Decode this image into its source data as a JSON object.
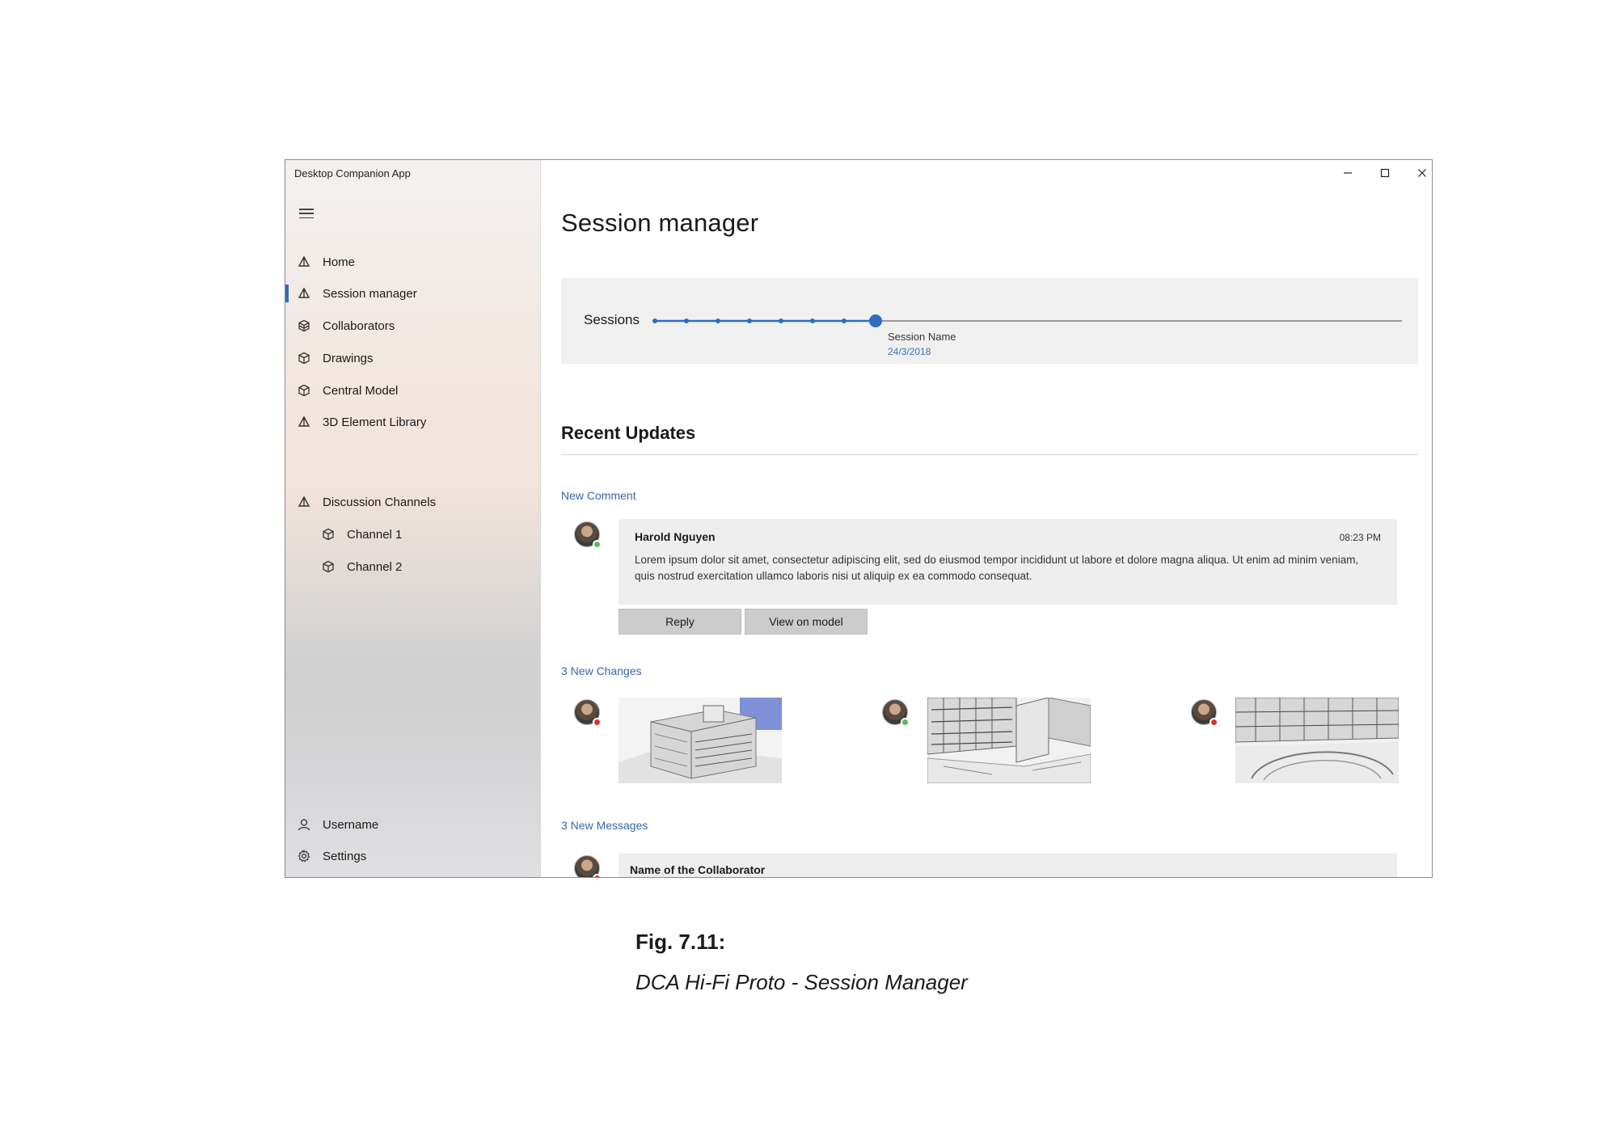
{
  "app": {
    "title": "Desktop Companion App",
    "accent_color": "#2f6dbd",
    "window_controls": [
      "minimize-icon",
      "maximize-icon",
      "close-icon"
    ]
  },
  "sidebar": {
    "menu_icon": "hamburger-icon",
    "items": [
      {
        "label": "Home",
        "icon": "pyramid-icon"
      },
      {
        "label": "Session manager",
        "icon": "pyramid-icon",
        "active": true
      },
      {
        "label": "Collaborators",
        "icon": "cube-stack-icon"
      },
      {
        "label": "Drawings",
        "icon": "cube-icon"
      },
      {
        "label": "Central Model",
        "icon": "cube-icon"
      },
      {
        "label": "3D Element Library",
        "icon": "pyramid-icon"
      }
    ],
    "channels": {
      "label": "Discussion Channels",
      "icon": "pyramid-icon",
      "items": [
        {
          "label": "Channel 1",
          "icon": "cube-icon"
        },
        {
          "label": "Channel 2",
          "icon": "cube-icon"
        }
      ]
    },
    "footer": [
      {
        "label": "Username",
        "icon": "person-icon"
      },
      {
        "label": "Settings",
        "icon": "gear-icon"
      }
    ]
  },
  "main": {
    "title": "Session manager",
    "sessions": {
      "label": "Sessions",
      "session_count": 8,
      "selected_index": 7,
      "selected_name": "Session Name",
      "selected_date": "24/3/2018"
    },
    "recent_updates": {
      "heading": "Recent Updates",
      "comment": {
        "label": "New Comment",
        "author": "Harold Nguyen",
        "time": "08:23 PM",
        "body": "Lorem ipsum dolor sit amet, consectetur adipiscing elit, sed do eiusmod tempor incididunt ut labore et dolore magna aliqua. Ut enim ad minim veniam, quis nostrud exercitation ullamco laboris nisi ut aliquip ex ea commodo consequat.",
        "status": "online",
        "reply_label": "Reply",
        "view_label": "View on model"
      },
      "changes": {
        "label": "3 New Changes",
        "items": [
          {
            "status": "busy"
          },
          {
            "status": "online"
          },
          {
            "status": "busy"
          }
        ]
      },
      "messages": {
        "label": "3 New Messages",
        "first_name": "Name of the Collaborator",
        "status": "busy"
      }
    },
    "status_colors": {
      "online": "#5cb85c",
      "busy": "#d9342b"
    }
  },
  "caption": {
    "number": "Fig. 7.11:",
    "text": "DCA Hi-Fi Proto - Session Manager"
  }
}
